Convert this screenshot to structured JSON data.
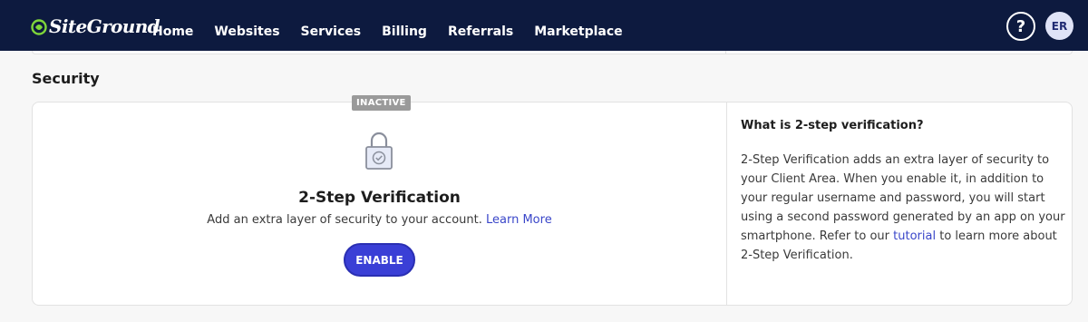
{
  "brand": {
    "name": "SiteGround"
  },
  "nav": {
    "items": [
      "Home",
      "Websites",
      "Services",
      "Billing",
      "Referrals",
      "Marketplace"
    ]
  },
  "header": {
    "help_label": "?",
    "avatar_initials": "ER"
  },
  "section": {
    "title": "Security"
  },
  "two_step": {
    "status_badge": "INACTIVE",
    "title": "2-Step Verification",
    "description": "Add an extra layer of security to your account.",
    "learn_more": "Learn More",
    "enable_label": "ENABLE"
  },
  "info": {
    "title": "What is 2-step verification?",
    "text_before_link": "2-Step Verification adds an extra layer of security to your Client Area. When you enable it, in addition to your regular username and password, you will start using a second password generated by an app on your smartphone. Refer to our",
    "link_label": "tutorial",
    "text_after_link": "to learn more about 2-Step Verification."
  },
  "colors": {
    "nav_bg": "#0d1a3f",
    "accent": "#3a3fd6",
    "link": "#3a46c9",
    "badge_inactive": "#9a9a9a"
  },
  "icons": {
    "logo": "siteground-logo-icon",
    "lock": "padlock-check-icon",
    "help": "question-mark-icon"
  }
}
